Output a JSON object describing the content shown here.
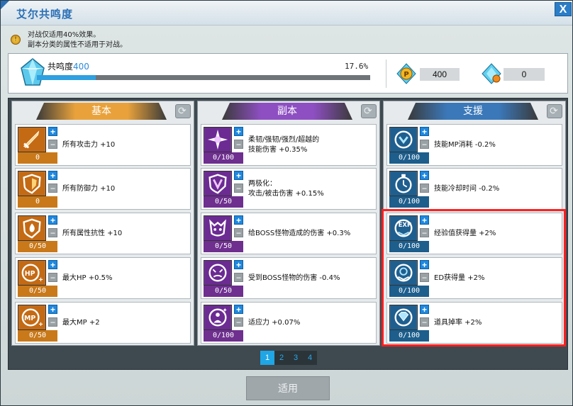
{
  "window": {
    "title": "艾尔共鸣度",
    "close_label": "X"
  },
  "notice": {
    "line1": "对战仅适用40%效果。",
    "line2": "副本分类的属性不适用于对战。"
  },
  "resonance": {
    "label": "共鸣度",
    "value": "400",
    "percent_text": "17.6%",
    "progress_fraction": 0.176
  },
  "currencies": [
    {
      "icon": "p-coin-icon",
      "value": "400"
    },
    {
      "icon": "crystal-coin-icon",
      "value": "0"
    }
  ],
  "columns": [
    {
      "title": "基本",
      "color": "#e9a23b",
      "items": [
        {
          "icon": "sword-icon",
          "count": "0",
          "desc": "所有攻击力 +10"
        },
        {
          "icon": "shield-icon",
          "count": "0",
          "desc": "所有防御力 +10"
        },
        {
          "icon": "flame-shield-icon",
          "count": "0/50",
          "desc": "所有属性抗性 +10"
        },
        {
          "icon": "hp-icon",
          "count": "0/50",
          "desc": "最大HP +0.5%"
        },
        {
          "icon": "mp-icon",
          "count": "0/50",
          "desc": "最大MP +2"
        }
      ]
    },
    {
      "title": "副本",
      "color": "#8e4fc2",
      "items": [
        {
          "icon": "burst-icon",
          "count": "0/100",
          "desc": "柔韧/强韧/强烈/超越的\n技能伤害 +0.35%"
        },
        {
          "icon": "polarity-icon",
          "count": "0/50",
          "desc": "两极化：\n攻击/被击伤害 +0.15%"
        },
        {
          "icon": "boss-attack-icon",
          "count": "0/50",
          "desc": "给BOSS怪物造成的伤害 +0.3%"
        },
        {
          "icon": "boss-defense-icon",
          "count": "0/50",
          "desc": "受到BOSS怪物的伤害 -0.4%"
        },
        {
          "icon": "adapt-icon",
          "count": "0/100",
          "desc": "适应力 +0.07%"
        }
      ]
    },
    {
      "title": "支援",
      "color": "#3b78b9",
      "items": [
        {
          "icon": "mp-cost-icon",
          "count": "0/100",
          "desc": "技能MP消耗 -0.2%"
        },
        {
          "icon": "stopwatch-icon",
          "count": "0/100",
          "desc": "技能冷却时间 -0.2%"
        },
        {
          "icon": "exp-icon",
          "count": "0/100",
          "desc": "经验值获得量 +2%"
        },
        {
          "icon": "ed-icon",
          "count": "0/100",
          "desc": "ED获得量 +2%"
        },
        {
          "icon": "gem-icon",
          "count": "0/100",
          "desc": "道具掉率 +2%"
        }
      ]
    }
  ],
  "pagination": {
    "pages": [
      "1",
      "2",
      "3",
      "4"
    ],
    "active": "1"
  },
  "apply_label": "适用"
}
